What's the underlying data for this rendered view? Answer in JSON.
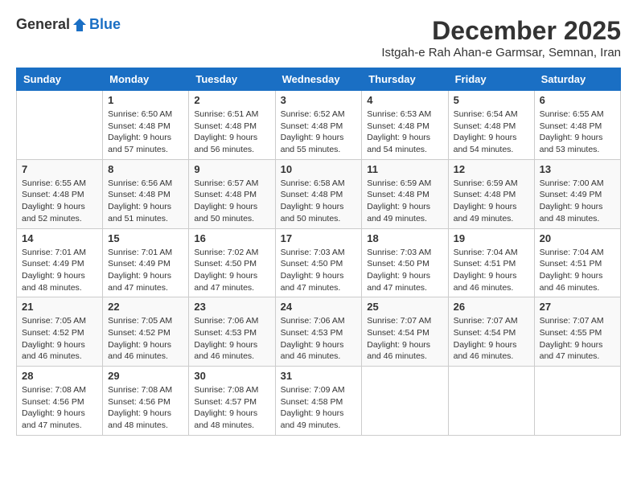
{
  "header": {
    "logo_general": "General",
    "logo_blue": "Blue",
    "month_title": "December 2025",
    "location": "Istgah-e Rah Ahan-e Garmsar, Semnan, Iran"
  },
  "days_of_week": [
    "Sunday",
    "Monday",
    "Tuesday",
    "Wednesday",
    "Thursday",
    "Friday",
    "Saturday"
  ],
  "weeks": [
    [
      {
        "num": "",
        "sunrise": "",
        "sunset": "",
        "daylight": ""
      },
      {
        "num": "1",
        "sunrise": "Sunrise: 6:50 AM",
        "sunset": "Sunset: 4:48 PM",
        "daylight": "Daylight: 9 hours and 57 minutes."
      },
      {
        "num": "2",
        "sunrise": "Sunrise: 6:51 AM",
        "sunset": "Sunset: 4:48 PM",
        "daylight": "Daylight: 9 hours and 56 minutes."
      },
      {
        "num": "3",
        "sunrise": "Sunrise: 6:52 AM",
        "sunset": "Sunset: 4:48 PM",
        "daylight": "Daylight: 9 hours and 55 minutes."
      },
      {
        "num": "4",
        "sunrise": "Sunrise: 6:53 AM",
        "sunset": "Sunset: 4:48 PM",
        "daylight": "Daylight: 9 hours and 54 minutes."
      },
      {
        "num": "5",
        "sunrise": "Sunrise: 6:54 AM",
        "sunset": "Sunset: 4:48 PM",
        "daylight": "Daylight: 9 hours and 54 minutes."
      },
      {
        "num": "6",
        "sunrise": "Sunrise: 6:55 AM",
        "sunset": "Sunset: 4:48 PM",
        "daylight": "Daylight: 9 hours and 53 minutes."
      }
    ],
    [
      {
        "num": "7",
        "sunrise": "Sunrise: 6:55 AM",
        "sunset": "Sunset: 4:48 PM",
        "daylight": "Daylight: 9 hours and 52 minutes."
      },
      {
        "num": "8",
        "sunrise": "Sunrise: 6:56 AM",
        "sunset": "Sunset: 4:48 PM",
        "daylight": "Daylight: 9 hours and 51 minutes."
      },
      {
        "num": "9",
        "sunrise": "Sunrise: 6:57 AM",
        "sunset": "Sunset: 4:48 PM",
        "daylight": "Daylight: 9 hours and 50 minutes."
      },
      {
        "num": "10",
        "sunrise": "Sunrise: 6:58 AM",
        "sunset": "Sunset: 4:48 PM",
        "daylight": "Daylight: 9 hours and 50 minutes."
      },
      {
        "num": "11",
        "sunrise": "Sunrise: 6:59 AM",
        "sunset": "Sunset: 4:48 PM",
        "daylight": "Daylight: 9 hours and 49 minutes."
      },
      {
        "num": "12",
        "sunrise": "Sunrise: 6:59 AM",
        "sunset": "Sunset: 4:48 PM",
        "daylight": "Daylight: 9 hours and 49 minutes."
      },
      {
        "num": "13",
        "sunrise": "Sunrise: 7:00 AM",
        "sunset": "Sunset: 4:49 PM",
        "daylight": "Daylight: 9 hours and 48 minutes."
      }
    ],
    [
      {
        "num": "14",
        "sunrise": "Sunrise: 7:01 AM",
        "sunset": "Sunset: 4:49 PM",
        "daylight": "Daylight: 9 hours and 48 minutes."
      },
      {
        "num": "15",
        "sunrise": "Sunrise: 7:01 AM",
        "sunset": "Sunset: 4:49 PM",
        "daylight": "Daylight: 9 hours and 47 minutes."
      },
      {
        "num": "16",
        "sunrise": "Sunrise: 7:02 AM",
        "sunset": "Sunset: 4:50 PM",
        "daylight": "Daylight: 9 hours and 47 minutes."
      },
      {
        "num": "17",
        "sunrise": "Sunrise: 7:03 AM",
        "sunset": "Sunset: 4:50 PM",
        "daylight": "Daylight: 9 hours and 47 minutes."
      },
      {
        "num": "18",
        "sunrise": "Sunrise: 7:03 AM",
        "sunset": "Sunset: 4:50 PM",
        "daylight": "Daylight: 9 hours and 47 minutes."
      },
      {
        "num": "19",
        "sunrise": "Sunrise: 7:04 AM",
        "sunset": "Sunset: 4:51 PM",
        "daylight": "Daylight: 9 hours and 46 minutes."
      },
      {
        "num": "20",
        "sunrise": "Sunrise: 7:04 AM",
        "sunset": "Sunset: 4:51 PM",
        "daylight": "Daylight: 9 hours and 46 minutes."
      }
    ],
    [
      {
        "num": "21",
        "sunrise": "Sunrise: 7:05 AM",
        "sunset": "Sunset: 4:52 PM",
        "daylight": "Daylight: 9 hours and 46 minutes."
      },
      {
        "num": "22",
        "sunrise": "Sunrise: 7:05 AM",
        "sunset": "Sunset: 4:52 PM",
        "daylight": "Daylight: 9 hours and 46 minutes."
      },
      {
        "num": "23",
        "sunrise": "Sunrise: 7:06 AM",
        "sunset": "Sunset: 4:53 PM",
        "daylight": "Daylight: 9 hours and 46 minutes."
      },
      {
        "num": "24",
        "sunrise": "Sunrise: 7:06 AM",
        "sunset": "Sunset: 4:53 PM",
        "daylight": "Daylight: 9 hours and 46 minutes."
      },
      {
        "num": "25",
        "sunrise": "Sunrise: 7:07 AM",
        "sunset": "Sunset: 4:54 PM",
        "daylight": "Daylight: 9 hours and 46 minutes."
      },
      {
        "num": "26",
        "sunrise": "Sunrise: 7:07 AM",
        "sunset": "Sunset: 4:54 PM",
        "daylight": "Daylight: 9 hours and 46 minutes."
      },
      {
        "num": "27",
        "sunrise": "Sunrise: 7:07 AM",
        "sunset": "Sunset: 4:55 PM",
        "daylight": "Daylight: 9 hours and 47 minutes."
      }
    ],
    [
      {
        "num": "28",
        "sunrise": "Sunrise: 7:08 AM",
        "sunset": "Sunset: 4:56 PM",
        "daylight": "Daylight: 9 hours and 47 minutes."
      },
      {
        "num": "29",
        "sunrise": "Sunrise: 7:08 AM",
        "sunset": "Sunset: 4:56 PM",
        "daylight": "Daylight: 9 hours and 48 minutes."
      },
      {
        "num": "30",
        "sunrise": "Sunrise: 7:08 AM",
        "sunset": "Sunset: 4:57 PM",
        "daylight": "Daylight: 9 hours and 48 minutes."
      },
      {
        "num": "31",
        "sunrise": "Sunrise: 7:09 AM",
        "sunset": "Sunset: 4:58 PM",
        "daylight": "Daylight: 9 hours and 49 minutes."
      },
      {
        "num": "",
        "sunrise": "",
        "sunset": "",
        "daylight": ""
      },
      {
        "num": "",
        "sunrise": "",
        "sunset": "",
        "daylight": ""
      },
      {
        "num": "",
        "sunrise": "",
        "sunset": "",
        "daylight": ""
      }
    ]
  ]
}
